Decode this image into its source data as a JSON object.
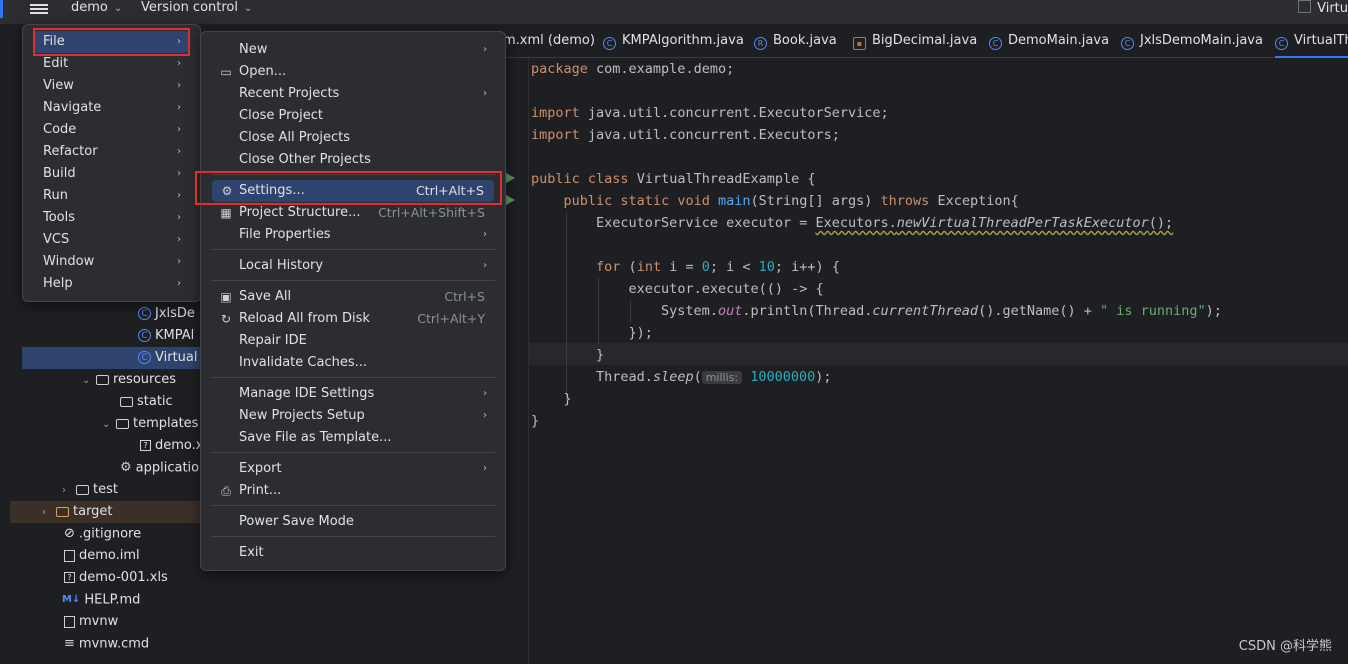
{
  "topbar": {
    "project": "demo",
    "vcs": "Version control",
    "right_label": "Virtu"
  },
  "project_tree": [
    {
      "label": "JxlsDe",
      "icon": "class-icon"
    },
    {
      "label": "KMPAl",
      "icon": "class-icon"
    },
    {
      "label": "Virtual",
      "icon": "class-icon"
    },
    {
      "label": "resources",
      "icon": "folder-icon"
    },
    {
      "label": "static",
      "icon": "folder-icon"
    },
    {
      "label": "templates",
      "icon": "folder-icon"
    },
    {
      "label": "demo.x",
      "icon": "unknown-file-icon"
    },
    {
      "label": "application",
      "icon": "gear-icon"
    },
    {
      "label": "test",
      "icon": "folder-icon"
    },
    {
      "label": "target",
      "icon": "folder-icon"
    },
    {
      "label": ".gitignore",
      "icon": "ignore-file-icon"
    },
    {
      "label": "demo.iml",
      "icon": "iml-file-icon"
    },
    {
      "label": "demo-001.xls",
      "icon": "unknown-file-icon"
    },
    {
      "label": "HELP.md",
      "icon": "markdown-icon"
    },
    {
      "label": "mvnw",
      "icon": "file-icon"
    },
    {
      "label": "mvnw.cmd",
      "icon": "text-file-icon"
    }
  ],
  "tabs": [
    {
      "label": "m.xml (demo)"
    },
    {
      "label": "KMPAlgorithm.java"
    },
    {
      "label": "Book.java"
    },
    {
      "label": "BigDecimal.java"
    },
    {
      "label": "DemoMain.java"
    },
    {
      "label": "JxlsDemoMain.java"
    },
    {
      "label": "VirtualThr"
    }
  ],
  "main_menu": [
    {
      "label": "File"
    },
    {
      "label": "Edit"
    },
    {
      "label": "View"
    },
    {
      "label": "Navigate"
    },
    {
      "label": "Code"
    },
    {
      "label": "Refactor"
    },
    {
      "label": "Build"
    },
    {
      "label": "Run"
    },
    {
      "label": "Tools"
    },
    {
      "label": "VCS"
    },
    {
      "label": "Window"
    },
    {
      "label": "Help"
    }
  ],
  "file_menu": {
    "new": "New",
    "open": "Open...",
    "recent_projects": "Recent Projects",
    "close_project": "Close Project",
    "close_all_projects": "Close All Projects",
    "close_other_projects": "Close Other Projects",
    "settings": "Settings...",
    "settings_shortcut": "Ctrl+Alt+S",
    "project_structure": "Project Structure...",
    "project_structure_shortcut": "Ctrl+Alt+Shift+S",
    "file_properties": "File Properties",
    "local_history": "Local History",
    "save_all": "Save All",
    "save_all_shortcut": "Ctrl+S",
    "reload_all": "Reload All from Disk",
    "reload_all_shortcut": "Ctrl+Alt+Y",
    "repair_ide": "Repair IDE",
    "invalidate_caches": "Invalidate Caches...",
    "manage_ide_settings": "Manage IDE Settings",
    "new_projects_setup": "New Projects Setup",
    "save_file_as_template": "Save File as Template...",
    "export": "Export",
    "print": "Print...",
    "power_save_mode": "Power Save Mode",
    "exit": "Exit"
  },
  "code": {
    "package_kw": "package",
    "package_name": " com.example.demo;",
    "import_kw": "import",
    "import1": " java.util.concurrent.ExecutorService;",
    "import2": " java.util.concurrent.Executors;",
    "public_kw": "public",
    "class_kw": " class ",
    "class_name": "VirtualThreadExample {",
    "static_void": " static void ",
    "main_fn": "main",
    "main_args": "(String[] args) ",
    "throws_kw": "throws",
    "main_tail": " Exception{",
    "exec_decl": "ExecutorService executor = ",
    "executors": "Executors.",
    "new_vt": "newVirtualThreadPerTaskExecutor",
    "exec_tail": "();",
    "for_kw": "for",
    "for_open": " (",
    "int_kw": "int",
    "for_i1": " i",
    "for_eq": " = ",
    "zero": "0",
    "for_mid": "; i < ",
    "ten": "10",
    "for_end": "; i++) {",
    "execute_line": "executor.execute(() -> {",
    "sys": "System.",
    "out": "out",
    "println": ".println(Thread.",
    "current": "currentThread",
    "getname": "().getName() + ",
    "running_str": "\" is running\"",
    "println_end": ");",
    "close_lambda": "});",
    "close_brace": "}",
    "thread_sleep": "Thread.",
    "sleep": "sleep",
    "paren_open": "(",
    "millis_hint": "millis:",
    "sleep_val": "10000000",
    "sleep_end": ");"
  },
  "watermark": "CSDN @科学熊"
}
